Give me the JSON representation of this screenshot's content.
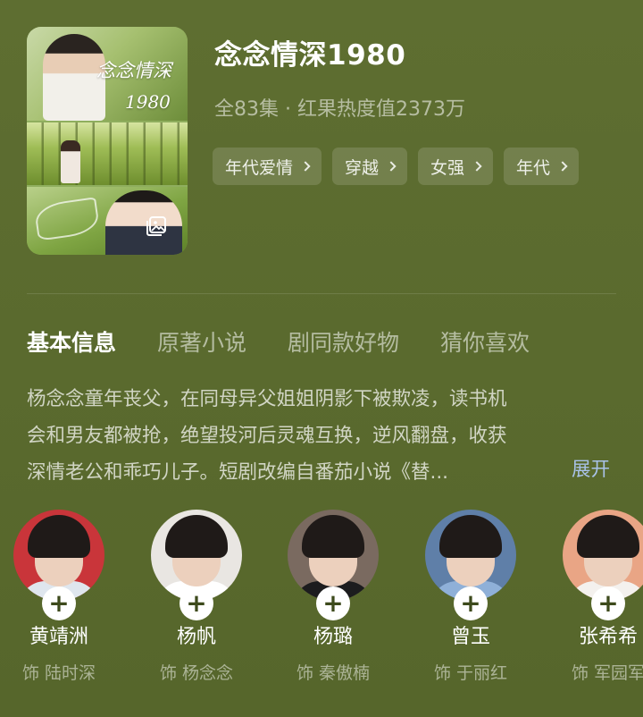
{
  "drama": {
    "title": "念念情深1980",
    "meta": "全83集 · 红果热度值2373万",
    "poster": {
      "title_text": "念念情深",
      "year_text": "1980"
    },
    "tags": [
      {
        "label": "年代爱情"
      },
      {
        "label": "穿越"
      },
      {
        "label": "女强"
      },
      {
        "label": "年代"
      }
    ]
  },
  "tabs": [
    {
      "label": "基本信息",
      "active": true
    },
    {
      "label": "原著小说",
      "active": false
    },
    {
      "label": "剧同款好物",
      "active": false
    },
    {
      "label": "猜你喜欢",
      "active": false
    }
  ],
  "synopsis": {
    "lines": [
      "杨念念童年丧父，在同母异父姐姐阴影下被欺凌，读书机",
      "会和男友都被抢，绝望投河后灵魂互换，逆风翻盘，收获",
      "深情老公和乖巧儿子。短剧改编自番茄小说《替..."
    ],
    "expand_label": "展开"
  },
  "cast": [
    {
      "name": "黄靖洲",
      "role": "饰 陆时深",
      "bg": "#c9353a"
    },
    {
      "name": "杨帆",
      "role": "饰 杨念念",
      "bg": "#e9e6e2"
    },
    {
      "name": "杨璐",
      "role": "饰 秦傲楠",
      "bg": "#7a6a60"
    },
    {
      "name": "曾玉",
      "role": "饰 于丽红",
      "bg": "#5f7fa8"
    },
    {
      "name": "张希希",
      "role": "饰 军园军",
      "bg": "#e9a585"
    }
  ],
  "colors": {
    "background": "#5a6a2e",
    "expand_link": "#a9c2e8",
    "plus_button": "#ffffff"
  }
}
